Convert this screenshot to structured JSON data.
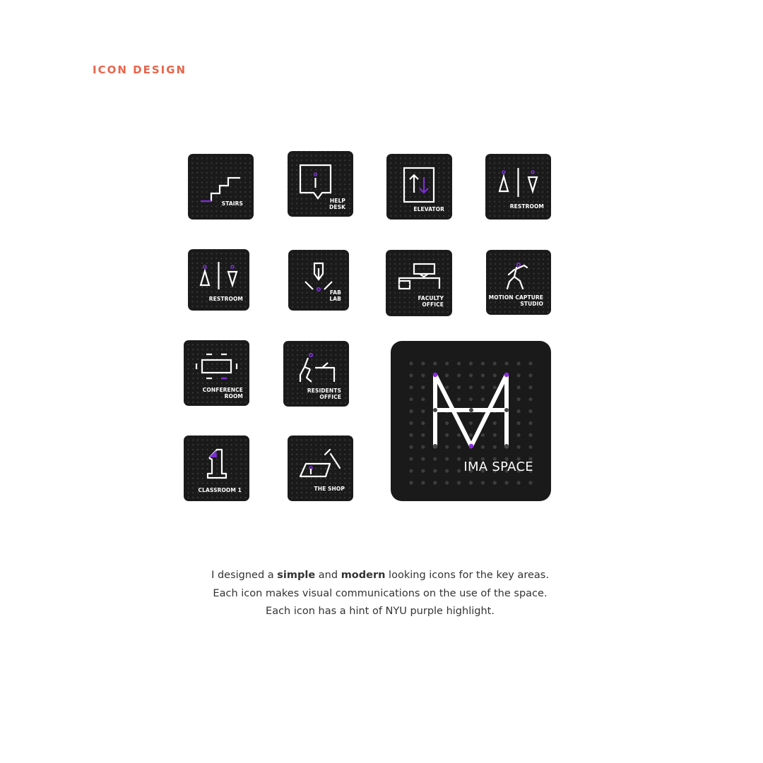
{
  "heading": "ICON DESIGN",
  "accent_color": "#7b2fd1",
  "heading_color": "#e8654c",
  "tiles": [
    {
      "label": "STAIRS",
      "icon": "stairs-icon"
    },
    {
      "label": "HELP\nDESK",
      "icon": "help-desk-icon"
    },
    {
      "label": "ELEVATOR",
      "icon": "elevator-icon"
    },
    {
      "label": "RESTROOM",
      "icon": "restroom-icon"
    },
    {
      "label": "RESTROOM",
      "icon": "restroom-icon"
    },
    {
      "label": "FAB\nLAB",
      "icon": "fab-lab-icon"
    },
    {
      "label": "FACULTY\nOFFICE",
      "icon": "faculty-office-icon"
    },
    {
      "label": "MOTION CAPTURE\nSTUDIO",
      "icon": "motion-capture-icon"
    },
    {
      "label": "CONFERENCE\nROOM",
      "icon": "conference-room-icon"
    },
    {
      "label": "RESIDENTS\nOFFICE",
      "icon": "residents-office-icon"
    },
    {
      "label": "CLASSROOM 1",
      "icon": "classroom-icon"
    },
    {
      "label": "THE SHOP",
      "icon": "shop-icon"
    }
  ],
  "logo": {
    "label": "IMA SPACE",
    "icon": "ima-logo-icon"
  },
  "description": {
    "line1": {
      "before": "I designed a ",
      "bold1": "simple",
      "middle": " and ",
      "bold2": "modern",
      "after": " looking icons for the key areas."
    },
    "line2": "Each icon makes visual communications on the use of the space.",
    "line3": "Each icon has a hint of NYU purple highlight."
  }
}
